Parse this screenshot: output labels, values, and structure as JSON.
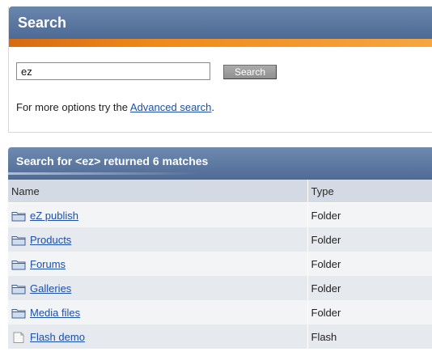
{
  "search": {
    "title": "Search",
    "input_value": "ez",
    "button_label": "Search",
    "more_options_prefix": "For more options try the ",
    "advanced_link": "Advanced search",
    "more_options_suffix": "."
  },
  "results": {
    "heading": "Search for <ez> returned 6 matches",
    "columns": {
      "name": "Name",
      "type": "Type"
    },
    "rows": [
      {
        "name": "eZ publish",
        "type": "Folder",
        "icon": "folder-icon"
      },
      {
        "name": "Products",
        "type": "Folder",
        "icon": "folder-icon"
      },
      {
        "name": "Forums",
        "type": "Folder",
        "icon": "folder-icon"
      },
      {
        "name": "Galleries",
        "type": "Folder",
        "icon": "folder-icon"
      },
      {
        "name": "Media files",
        "type": "Folder",
        "icon": "folder-icon"
      },
      {
        "name": "Flash demo",
        "type": "Flash",
        "icon": "document-icon"
      }
    ]
  },
  "colors": {
    "header_blue": "#4d6a95",
    "accent_orange": "#f08a1a",
    "link_blue": "#1b4fa8"
  }
}
